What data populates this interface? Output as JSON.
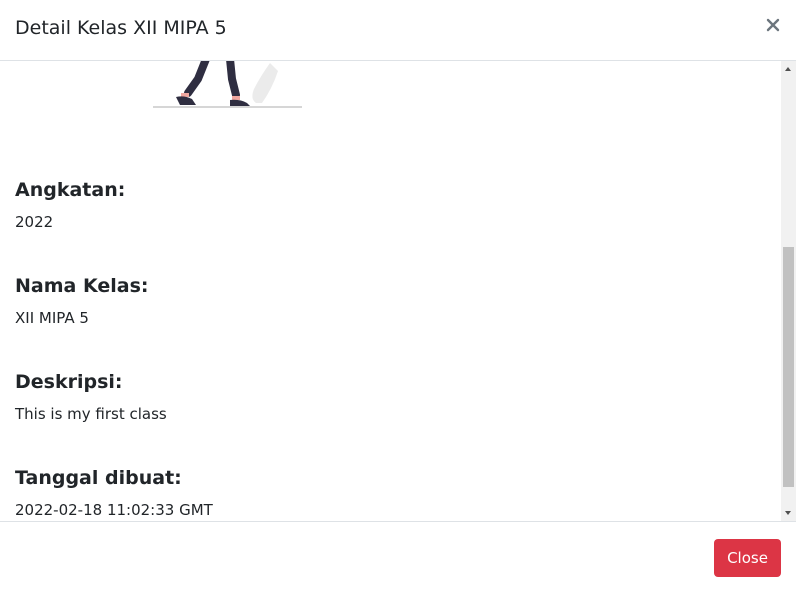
{
  "header": {
    "title": "Detail Kelas XII MIPA 5",
    "close_icon": "close-icon"
  },
  "body": {
    "illustration": "person-walking-illustration",
    "fields": [
      {
        "label": "Angkatan:",
        "value": "2022"
      },
      {
        "label": "Nama Kelas:",
        "value": "XII MIPA 5"
      },
      {
        "label": "Deskripsi:",
        "value": "This is my first class"
      },
      {
        "label": "Tanggal dibuat:",
        "value": "2022-02-18 11:02:33 GMT"
      }
    ]
  },
  "footer": {
    "close_label": "Close"
  },
  "colors": {
    "danger": "#dc3545",
    "border": "#dee2e6",
    "text": "#212529"
  }
}
